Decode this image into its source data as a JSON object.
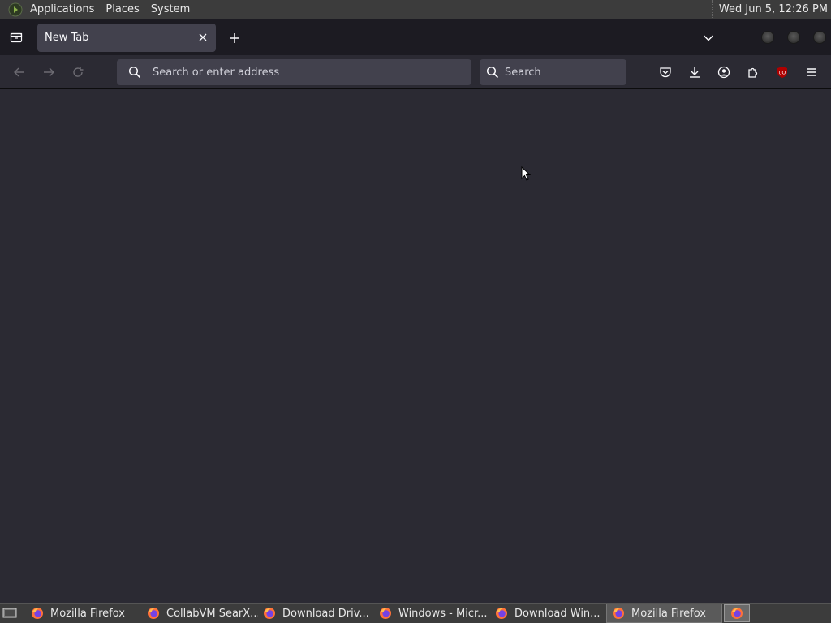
{
  "top_panel": {
    "menus": [
      "Applications",
      "Places",
      "System"
    ],
    "clock": "Wed Jun  5, 12:26 PM"
  },
  "browser": {
    "tab": {
      "title": "New Tab"
    },
    "urlbar": {
      "placeholder": "Search or enter address"
    },
    "searchbar": {
      "placeholder": "Search"
    }
  },
  "taskbar": {
    "tasks": [
      {
        "label": "Mozilla Firefox",
        "active": false
      },
      {
        "label": "CollabVM SearX...",
        "active": false
      },
      {
        "label": "Download Driv...",
        "active": false
      },
      {
        "label": "Windows - Micr...",
        "active": false
      },
      {
        "label": "Download Win...",
        "active": false
      },
      {
        "label": "Mozilla Firefox",
        "active": true
      }
    ]
  },
  "colors": {
    "page_bg": "#2b2a33",
    "tabstrip_bg": "#1c1b22",
    "field_bg": "#42414d",
    "panel_bg": "#3c3c3c",
    "ublock_red": "#b00000"
  },
  "icons": {
    "panel_logo": "mate-menu-icon",
    "tab_list": "firefox-view-icon",
    "tab_close": "close-icon",
    "new_tab": "plus-icon",
    "tabs_dropdown": "chevron-down-icon",
    "back": "arrow-left-icon",
    "forward": "arrow-right-icon",
    "reload": "reload-icon",
    "url_search": "search-icon",
    "pocket": "pocket-icon",
    "downloads": "download-icon",
    "account": "account-icon",
    "extensions": "puzzle-icon",
    "ublock": "ublock-origin-icon",
    "menu": "hamburger-menu-icon"
  }
}
